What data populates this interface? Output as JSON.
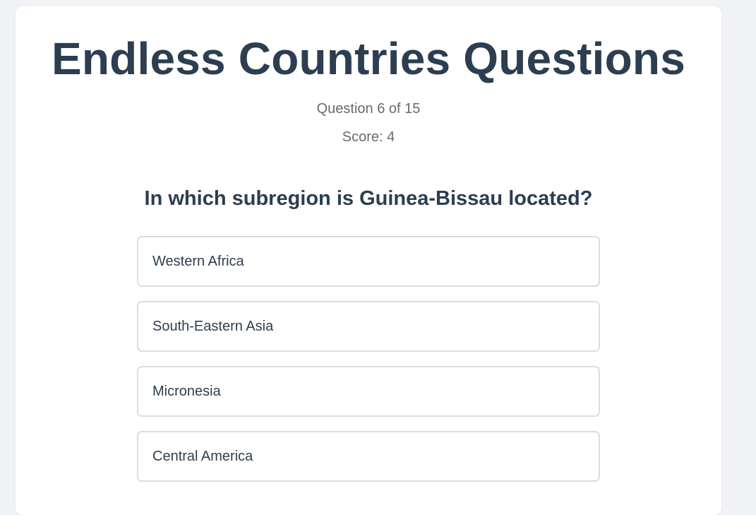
{
  "quiz": {
    "title": "Endless Countries Questions",
    "progress_text": "Question 6 of 15",
    "score_text": "Score: 4",
    "question": "In which subregion is Guinea-Bissau located?",
    "options": [
      {
        "label": "Western Africa"
      },
      {
        "label": "South-Eastern Asia"
      },
      {
        "label": "Micronesia"
      },
      {
        "label": "Central America"
      }
    ]
  },
  "colors": {
    "page_background": "#f1f2f6",
    "card_background": "#ffffff",
    "heading_text": "#2c3e50",
    "meta_text": "#666b70",
    "option_border": "#dcdde0"
  }
}
